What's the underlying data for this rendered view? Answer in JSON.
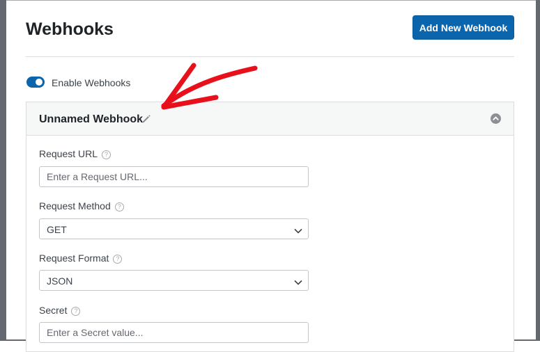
{
  "header": {
    "title": "Webhooks",
    "add_button_label": "Add New Webhook"
  },
  "toggle": {
    "label": "Enable Webhooks",
    "enabled": true
  },
  "webhook": {
    "name": "Unnamed Webhook",
    "fields": {
      "request_url": {
        "label": "Request URL",
        "placeholder": "Enter a Request URL...",
        "help": "?"
      },
      "request_method": {
        "label": "Request Method",
        "value": "GET",
        "help": "?"
      },
      "request_format": {
        "label": "Request Format",
        "value": "JSON",
        "help": "?"
      },
      "secret": {
        "label": "Secret",
        "placeholder": "Enter a Secret value...",
        "help": "?"
      }
    }
  },
  "colors": {
    "primary": "#0a65ad",
    "annotation_arrow": "#e8111b"
  },
  "icons": {
    "edit": "pencil-icon",
    "collapse": "chevron-up-circle-icon",
    "help": "question-circle-icon",
    "dropdown": "chevron-down-icon"
  }
}
